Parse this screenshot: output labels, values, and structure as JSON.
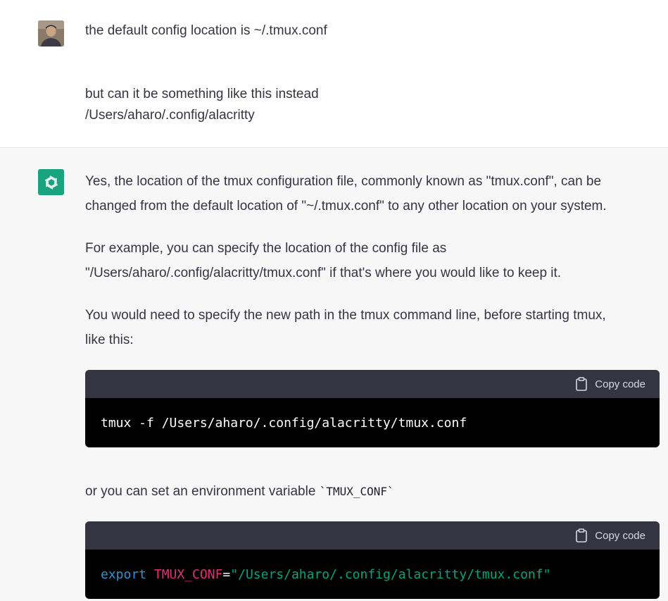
{
  "user_message": {
    "line1": "the default config location is ~/.tmux.conf",
    "line2": "but can it be something like this instead",
    "line3": "/Users/aharo/.config/alacritty"
  },
  "assistant_message": {
    "p1_l1": "Yes, the location of the tmux configuration file, commonly known as \"tmux.conf\", can be",
    "p1_l2": "changed from the default location of \"~/.tmux.conf\" to any other location on your system.",
    "p2_l1": "For example, you can specify the location of the config file as",
    "p2_l2": "\"/Users/aharo/.config/alacritty/tmux.conf\" if that's where you would like to keep it.",
    "p3_l1": "You would need to specify the new path in the tmux command line, before starting tmux,",
    "p3_l2": "like this:",
    "code1": "tmux -f /Users/aharo/.config/alacritty/tmux.conf",
    "p4_prefix": "or you can set an environment variable ",
    "p4_code": "`TMUX_CONF`",
    "code2": {
      "keyword": "export",
      "var": "TMUX_CONF",
      "eq": "=",
      "value": "\"/Users/aharo/.config/alacritty/tmux.conf\""
    }
  },
  "copy_label": "Copy code",
  "icons": {
    "avatar": "user-avatar",
    "logo": "openai-logo-icon",
    "copy": "clipboard-icon"
  },
  "colors": {
    "logo_bg": "#19a37f",
    "code_keyword": "#2e95d3",
    "code_var": "#df3079",
    "code_string": "#00a67d"
  }
}
